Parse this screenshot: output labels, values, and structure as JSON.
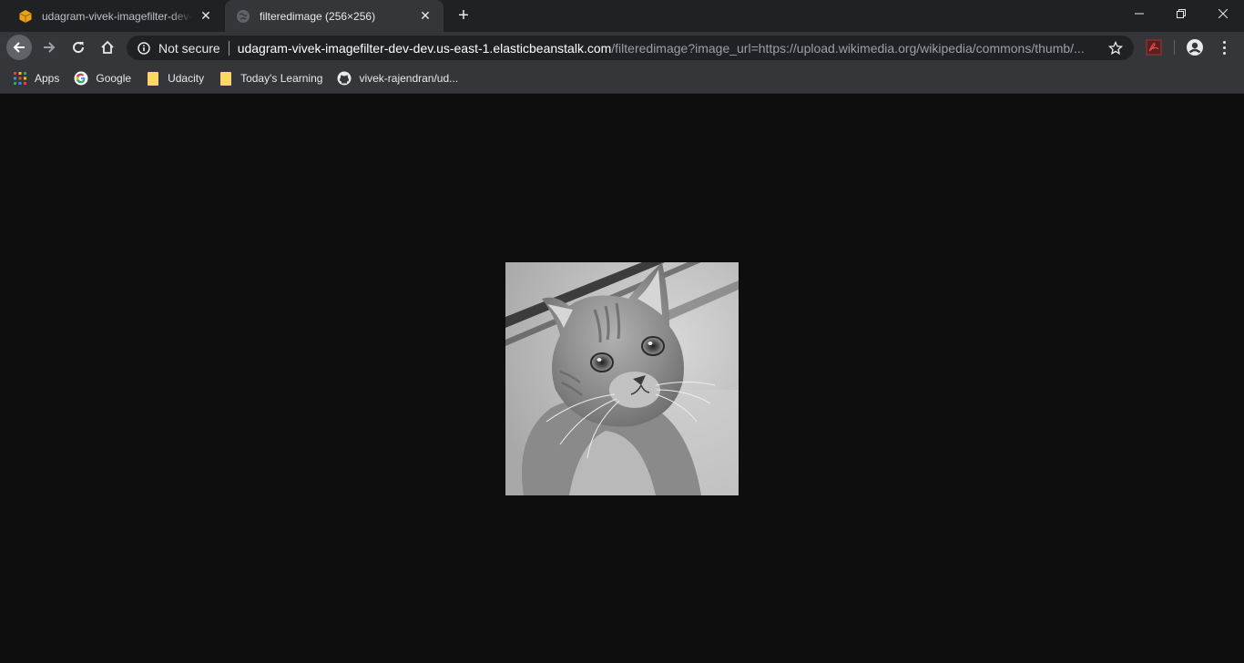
{
  "tabs": [
    {
      "title": "udagram-vivek-imagefilter-dev-dev",
      "icon": "package-icon",
      "close_label": "✕"
    },
    {
      "title": "filteredimage (256×256)",
      "icon": "globe-icon",
      "close_label": "✕"
    }
  ],
  "new_tab_label": "+",
  "window_controls": {
    "minimize": "minimize-icon",
    "maximize": "restore-icon",
    "close": "close-icon"
  },
  "toolbar": {
    "security_label": "Not secure",
    "url_host": "udagram-vivek-imagefilter-dev-dev.us-east-1.elasticbeanstalk.com",
    "url_path": "/filteredimage?image_url=https://upload.wikimedia.org/wikipedia/commons/thumb/..."
  },
  "bookmarks": [
    {
      "label": "Apps",
      "icon": "apps-grid-icon"
    },
    {
      "label": "Google",
      "icon": "google-icon"
    },
    {
      "label": "Udacity",
      "icon": "folder-icon"
    },
    {
      "label": "Today's Learning",
      "icon": "folder-icon"
    },
    {
      "label": "vivek-rajendran/ud...",
      "icon": "github-icon"
    }
  ],
  "content": {
    "image_description_icon": "grayscale-cat-photo"
  },
  "colors": {
    "chrome_dark": "#202124",
    "toolbar": "#35363a",
    "viewport_bg": "#0e0e0e",
    "folder_yellow": "#fdd663"
  }
}
